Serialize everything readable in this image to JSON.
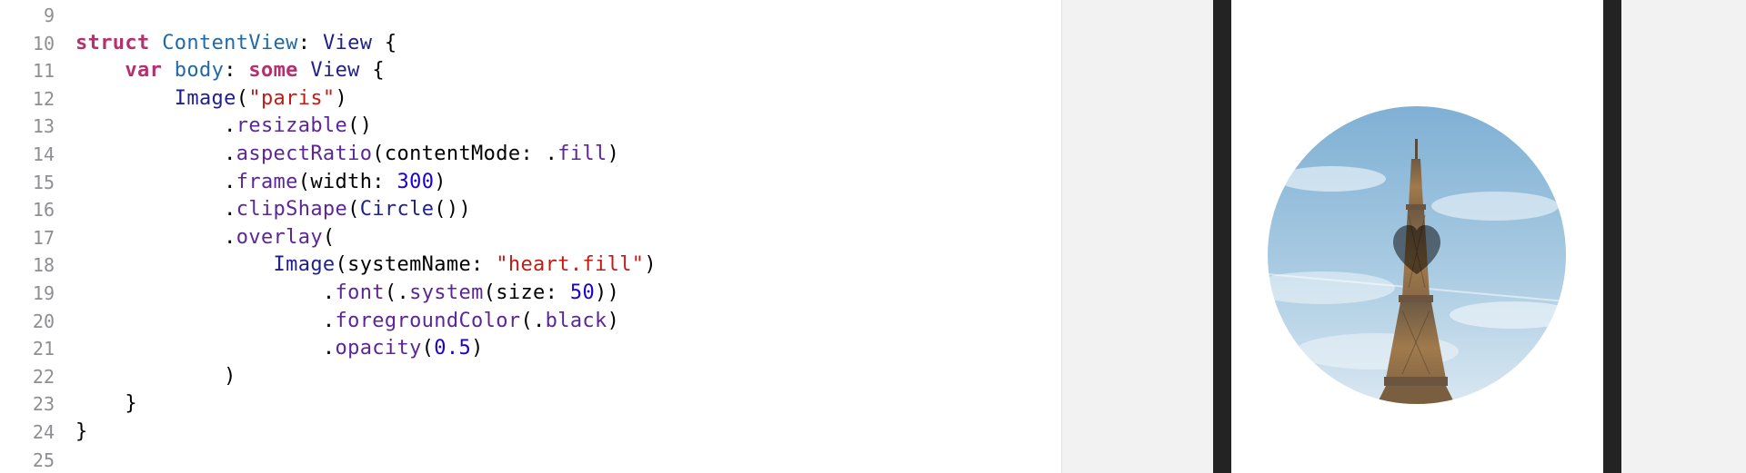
{
  "editor": {
    "lines": [
      {
        "no": "9",
        "tokens": []
      },
      {
        "no": "10",
        "tokens": [
          {
            "t": "struct",
            "c": "kw"
          },
          {
            "t": " ",
            "c": "pln"
          },
          {
            "t": "ContentView",
            "c": "decl"
          },
          {
            "t": ": ",
            "c": "pln"
          },
          {
            "t": "View",
            "c": "type"
          },
          {
            "t": " {",
            "c": "pln"
          }
        ]
      },
      {
        "no": "11",
        "tokens": [
          {
            "t": "    ",
            "c": "pln"
          },
          {
            "t": "var",
            "c": "kw"
          },
          {
            "t": " ",
            "c": "pln"
          },
          {
            "t": "body",
            "c": "decl"
          },
          {
            "t": ": ",
            "c": "pln"
          },
          {
            "t": "some",
            "c": "kw"
          },
          {
            "t": " ",
            "c": "pln"
          },
          {
            "t": "View",
            "c": "type"
          },
          {
            "t": " {",
            "c": "pln"
          }
        ]
      },
      {
        "no": "12",
        "tokens": [
          {
            "t": "        ",
            "c": "pln"
          },
          {
            "t": "Image",
            "c": "type"
          },
          {
            "t": "(",
            "c": "pln"
          },
          {
            "t": "\"paris\"",
            "c": "str"
          },
          {
            "t": ")",
            "c": "pln"
          }
        ]
      },
      {
        "no": "13",
        "tokens": [
          {
            "t": "            .",
            "c": "pln"
          },
          {
            "t": "resizable",
            "c": "mth"
          },
          {
            "t": "()",
            "c": "pln"
          }
        ]
      },
      {
        "no": "14",
        "tokens": [
          {
            "t": "            .",
            "c": "pln"
          },
          {
            "t": "aspectRatio",
            "c": "mth"
          },
          {
            "t": "(contentMode: .",
            "c": "pln"
          },
          {
            "t": "fill",
            "c": "mth"
          },
          {
            "t": ")",
            "c": "pln"
          }
        ]
      },
      {
        "no": "15",
        "tokens": [
          {
            "t": "            .",
            "c": "pln"
          },
          {
            "t": "frame",
            "c": "mth"
          },
          {
            "t": "(width: ",
            "c": "pln"
          },
          {
            "t": "300",
            "c": "num"
          },
          {
            "t": ")",
            "c": "pln"
          }
        ]
      },
      {
        "no": "16",
        "tokens": [
          {
            "t": "            .",
            "c": "pln"
          },
          {
            "t": "clipShape",
            "c": "mth"
          },
          {
            "t": "(",
            "c": "pln"
          },
          {
            "t": "Circle",
            "c": "type"
          },
          {
            "t": "())",
            "c": "pln"
          }
        ]
      },
      {
        "no": "17",
        "tokens": [
          {
            "t": "            .",
            "c": "pln"
          },
          {
            "t": "overlay",
            "c": "mth"
          },
          {
            "t": "(",
            "c": "pln"
          }
        ]
      },
      {
        "no": "18",
        "tokens": [
          {
            "t": "                ",
            "c": "pln"
          },
          {
            "t": "Image",
            "c": "type"
          },
          {
            "t": "(systemName: ",
            "c": "pln"
          },
          {
            "t": "\"heart.fill\"",
            "c": "str"
          },
          {
            "t": ")",
            "c": "pln"
          }
        ]
      },
      {
        "no": "19",
        "tokens": [
          {
            "t": "                    .",
            "c": "pln"
          },
          {
            "t": "font",
            "c": "mth"
          },
          {
            "t": "(.",
            "c": "pln"
          },
          {
            "t": "system",
            "c": "mth"
          },
          {
            "t": "(size: ",
            "c": "pln"
          },
          {
            "t": "50",
            "c": "num"
          },
          {
            "t": "))",
            "c": "pln"
          }
        ]
      },
      {
        "no": "20",
        "tokens": [
          {
            "t": "                    .",
            "c": "pln"
          },
          {
            "t": "foregroundColor",
            "c": "mth"
          },
          {
            "t": "(.",
            "c": "pln"
          },
          {
            "t": "black",
            "c": "mth"
          },
          {
            "t": ")",
            "c": "pln"
          }
        ]
      },
      {
        "no": "21",
        "tokens": [
          {
            "t": "                    .",
            "c": "pln"
          },
          {
            "t": "opacity",
            "c": "mth"
          },
          {
            "t": "(",
            "c": "pln"
          },
          {
            "t": "0.5",
            "c": "num"
          },
          {
            "t": ")",
            "c": "pln"
          }
        ]
      },
      {
        "no": "22",
        "tokens": [
          {
            "t": "            )",
            "c": "pln"
          }
        ]
      },
      {
        "no": "23",
        "tokens": [
          {
            "t": "    }",
            "c": "pln"
          }
        ]
      },
      {
        "no": "24",
        "tokens": [
          {
            "t": "}",
            "c": "pln"
          }
        ]
      },
      {
        "no": "25",
        "tokens": []
      }
    ]
  },
  "preview": {
    "image_icon": "eiffel-tower-photo",
    "overlay_icon": "heart-fill-icon",
    "overlay_color": "#000000",
    "overlay_opacity": 0.5,
    "sky_color": "#8ab8d8",
    "bezel_color": "#232323"
  }
}
